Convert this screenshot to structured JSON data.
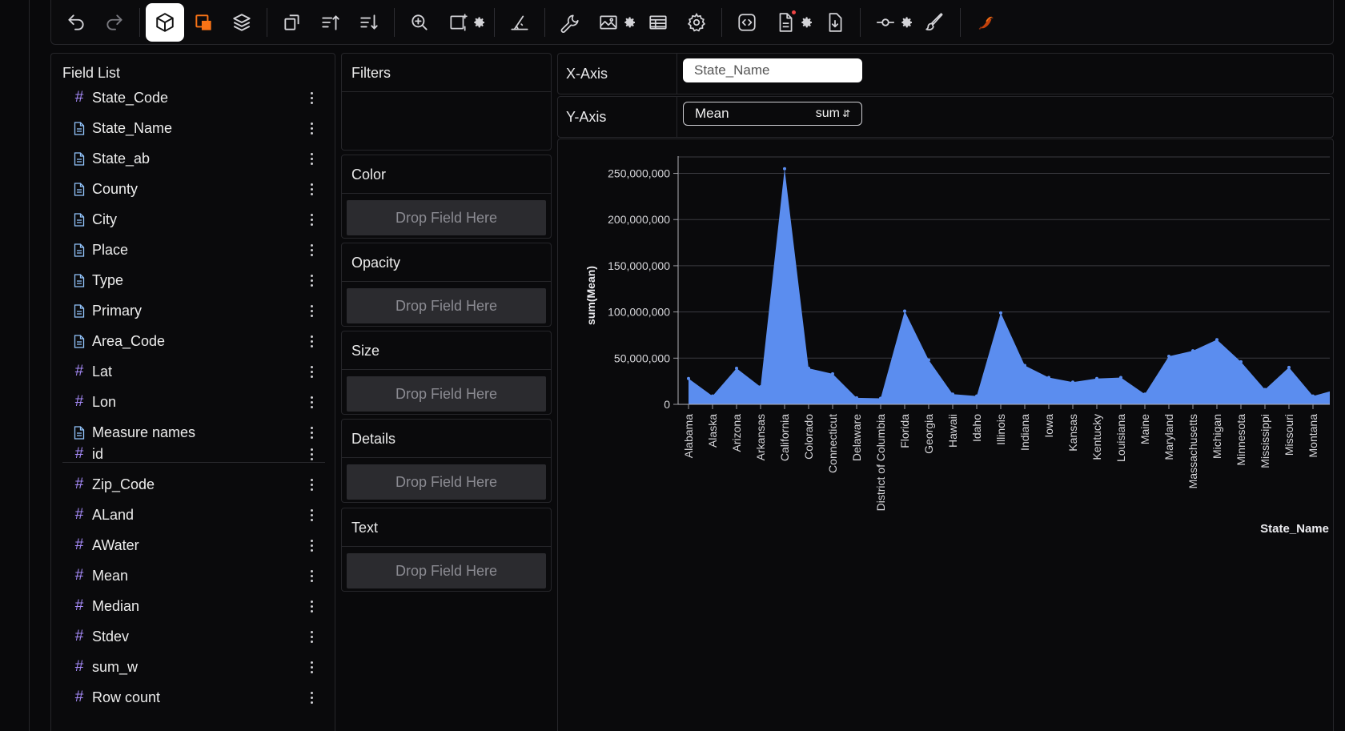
{
  "fieldList": {
    "title": "Field List",
    "dimensions": [
      {
        "name": "State_Code",
        "type": "number"
      },
      {
        "name": "State_Name",
        "type": "string"
      },
      {
        "name": "State_ab",
        "type": "string"
      },
      {
        "name": "County",
        "type": "string"
      },
      {
        "name": "City",
        "type": "string"
      },
      {
        "name": "Place",
        "type": "string"
      },
      {
        "name": "Type",
        "type": "string"
      },
      {
        "name": "Primary",
        "type": "string"
      },
      {
        "name": "Area_Code",
        "type": "string"
      },
      {
        "name": "Lat",
        "type": "number"
      },
      {
        "name": "Lon",
        "type": "number"
      },
      {
        "name": "Measure names",
        "type": "string"
      }
    ],
    "measures": [
      {
        "name": "id",
        "type": "number"
      },
      {
        "name": "Zip_Code",
        "type": "number"
      },
      {
        "name": "ALand",
        "type": "number"
      },
      {
        "name": "AWater",
        "type": "number"
      },
      {
        "name": "Mean",
        "type": "number"
      },
      {
        "name": "Median",
        "type": "number"
      },
      {
        "name": "Stdev",
        "type": "number"
      },
      {
        "name": "sum_w",
        "type": "number"
      },
      {
        "name": "Row count",
        "type": "number"
      }
    ]
  },
  "encodings": {
    "filters": {
      "title": "Filters"
    },
    "color": {
      "title": "Color",
      "placeholder": "Drop Field Here"
    },
    "opacity": {
      "title": "Opacity",
      "placeholder": "Drop Field Here"
    },
    "size": {
      "title": "Size",
      "placeholder": "Drop Field Here"
    },
    "details": {
      "title": "Details",
      "placeholder": "Drop Field Here"
    },
    "text": {
      "title": "Text",
      "placeholder": "Drop Field Here"
    }
  },
  "axes": {
    "x": {
      "label": "X-Axis",
      "field": "State_Name"
    },
    "y": {
      "label": "Y-Axis",
      "field": "Mean",
      "aggregate": "sum"
    }
  },
  "toolbar": {
    "icons": [
      "undo-icon",
      "redo-icon",
      "cube-icon",
      "square-fill-icon",
      "layers-icon",
      "transpose-icon",
      "sort-asc-icon",
      "sort-desc-icon",
      "zoom-icon",
      "resize-icon",
      "gear-icon",
      "axis-icon",
      "wrench-icon",
      "image-icon",
      "gear-icon",
      "table-icon",
      "settings-icon",
      "code-icon",
      "document-icon",
      "gear-icon",
      "download-icon",
      "slider-icon",
      "gear-icon",
      "brush-icon",
      "bird-logo-icon"
    ]
  },
  "colors": {
    "area": "#5b8def",
    "accent": "#f97316",
    "hash": "#a78bfa"
  },
  "chart_data": {
    "type": "area",
    "xlabel": "State_Name",
    "ylabel": "sum(Mean)",
    "ylim": [
      0,
      260000000
    ],
    "yticks": [
      0,
      50000000,
      100000000,
      150000000,
      200000000,
      250000000
    ],
    "ytick_labels": [
      "0",
      "50,000,000",
      "100,000,000",
      "150,000,000",
      "200,000,000",
      "250,000,000"
    ],
    "categories": [
      "Alabama",
      "Alaska",
      "Arizona",
      "Arkansas",
      "California",
      "Colorado",
      "Connecticut",
      "Delaware",
      "District of Columbia",
      "Florida",
      "Georgia",
      "Hawaii",
      "Idaho",
      "Illinois",
      "Indiana",
      "Iowa",
      "Kansas",
      "Kentucky",
      "Louisiana",
      "Maine",
      "Maryland",
      "Massachusetts",
      "Michigan",
      "Minnesota",
      "Mississippi",
      "Missouri",
      "Montana"
    ],
    "values": [
      28000000,
      9000000,
      39000000,
      19000000,
      255000000,
      39000000,
      33000000,
      7000000,
      6500000,
      101000000,
      48000000,
      11000000,
      9000000,
      99000000,
      42000000,
      29000000,
      24000000,
      28000000,
      29000000,
      11000000,
      52000000,
      58000000,
      70000000,
      46000000,
      16000000,
      40000000,
      9000000
    ],
    "trailing_value": 14000000,
    "grid": true
  }
}
